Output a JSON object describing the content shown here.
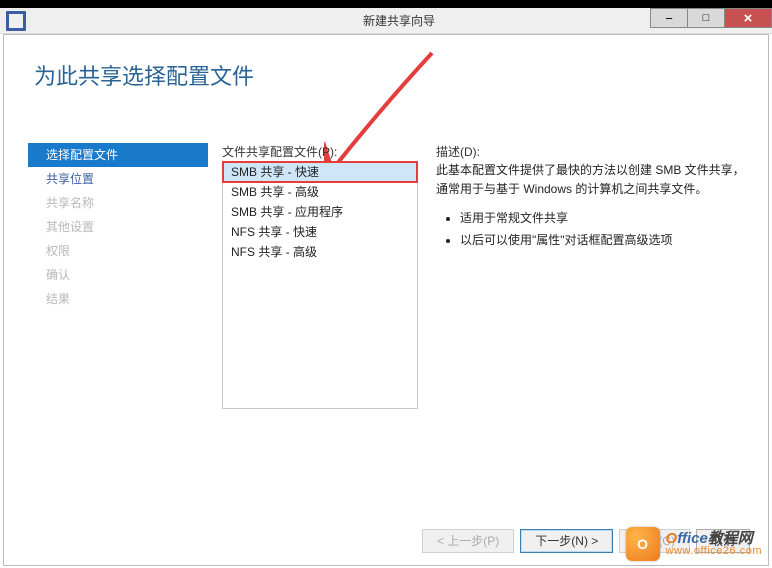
{
  "window": {
    "title": "新建共享向导"
  },
  "header": {
    "title": "为此共享选择配置文件"
  },
  "nav": {
    "items": [
      {
        "label": "选择配置文件",
        "state": "active"
      },
      {
        "label": "共享位置",
        "state": "enabled"
      },
      {
        "label": "共享名称",
        "state": "disabled"
      },
      {
        "label": "其他设置",
        "state": "disabled"
      },
      {
        "label": "权限",
        "state": "disabled"
      },
      {
        "label": "确认",
        "state": "disabled"
      },
      {
        "label": "结果",
        "state": "disabled"
      }
    ]
  },
  "profile_list": {
    "label": "文件共享配置文件(P):",
    "items": [
      {
        "label": "SMB 共享 - 快速",
        "selected": true
      },
      {
        "label": "SMB 共享 - 高级",
        "selected": false
      },
      {
        "label": "SMB 共享 - 应用程序",
        "selected": false
      },
      {
        "label": "NFS 共享 - 快速",
        "selected": false
      },
      {
        "label": "NFS 共享 - 高级",
        "selected": false
      }
    ]
  },
  "description": {
    "label": "描述(D):",
    "text": "此基本配置文件提供了最快的方法以创建 SMB 文件共享，通常用于与基于 Windows 的计算机之间共享文件。",
    "bullets": [
      "适用于常规文件共享",
      "以后可以使用\"属性\"对话框配置高级选项"
    ]
  },
  "footer": {
    "prev": "< 上一步(P)",
    "next": "下一步(N) >",
    "create": "创建(C)",
    "cancel": "取消"
  },
  "watermark": {
    "brand": "Office教程网",
    "url": "www.office26.com"
  }
}
